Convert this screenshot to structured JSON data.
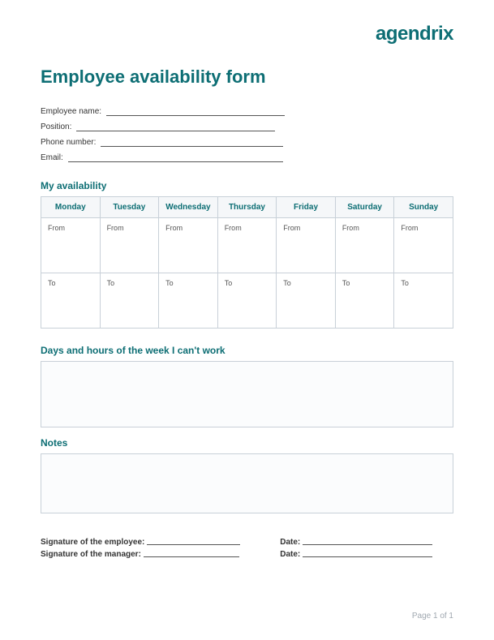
{
  "brand": {
    "logo_text": "agendrix"
  },
  "title": "Employee availability form",
  "info_fields": {
    "employee_name": {
      "label": "Employee name:",
      "line_width": 220
    },
    "position": {
      "label": "Position:",
      "line_width": 245
    },
    "phone_number": {
      "label": "Phone number:",
      "line_width": 225
    },
    "email": {
      "label": "Email:",
      "line_width": 265
    }
  },
  "sections": {
    "availability_header": "My availability",
    "cant_work_header": "Days and hours of the week I can't work",
    "notes_header": "Notes"
  },
  "availability_table": {
    "days": [
      "Monday",
      "Tuesday",
      "Wednesday",
      "Thursday",
      "Friday",
      "Saturday",
      "Sunday"
    ],
    "from_label": "From",
    "to_label": "To"
  },
  "signatures": {
    "employee_sig": {
      "label": "Signature of the employee:",
      "line_width": 115
    },
    "manager_sig": {
      "label": "Signature of the manager:",
      "line_width": 118
    },
    "date1": {
      "label": "Date:",
      "line_width": 160
    },
    "date2": {
      "label": "Date:",
      "line_width": 160
    }
  },
  "footer": {
    "page_text": "Page 1 of 1"
  }
}
